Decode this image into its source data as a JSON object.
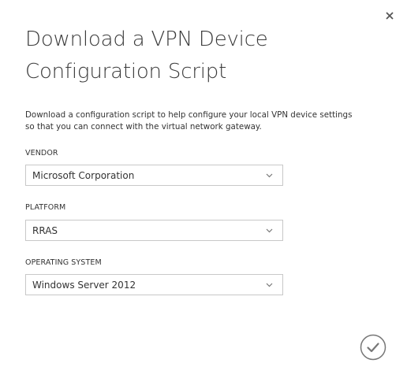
{
  "dialog": {
    "title": "Download a VPN Device Configuration Script",
    "description": "Download a configuration script to help configure your local VPN device settings so that you can connect with the virtual network gateway."
  },
  "fields": {
    "vendor": {
      "label": "VENDOR",
      "value": "Microsoft Corporation"
    },
    "platform": {
      "label": "PLATFORM",
      "value": "RRAS"
    },
    "os": {
      "label": "OPERATING SYSTEM",
      "value": "Windows Server 2012"
    }
  },
  "icons": {
    "close": "close-icon",
    "chevron": "chevron-down-icon",
    "confirm": "checkmark-icon"
  },
  "colors": {
    "border": "#c8c8c8",
    "text": "#333333",
    "icon": "#777777"
  }
}
